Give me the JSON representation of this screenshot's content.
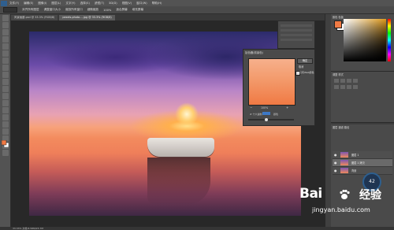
{
  "menubar": {
    "items": [
      "文件(F)",
      "编辑(E)",
      "图像(I)",
      "图层(L)",
      "文字(Y)",
      "选择(S)",
      "滤镜(T)",
      "3D(D)",
      "视图(V)",
      "窗口(W)",
      "帮助(H)"
    ]
  },
  "optionsbar": {
    "items": [
      "对齐所有图层",
      "调整窗口大小",
      "缩放所有窗口",
      "细微缩放",
      "100%",
      "适合屏幕",
      "填充屏幕"
    ]
  },
  "tabs": [
    "风景画廊.psd @ 33.3% (RGB/8)",
    "pexels-photo-...jpg @ 33.3% (RGB/8)"
  ],
  "colorpicker": {
    "title": "拾色器(前景色)",
    "ok": "确定",
    "cancel": "取消",
    "only_web": "只有Web颜色",
    "zoom": "100%",
    "zoom_minus": "−",
    "zoom_plus": "+",
    "hex_label": "# 十六进制",
    "hex_suffix": "颜色",
    "swatch_color": "#f39a6b"
  },
  "colorpanel": {
    "tabs": "颜色  色板",
    "fg_color": "#f07a44"
  },
  "adjpanel": {
    "tabs": "调整  样式"
  },
  "layerpanel": {
    "tabs": "图层  通道  路径",
    "layers": [
      {
        "name": "图层 1"
      },
      {
        "name": "图层 1 拷贝"
      },
      {
        "name": "背景"
      }
    ]
  },
  "zoom_badge": "42",
  "statusbar": {
    "text": "33.33%   文档:8.58M/25.7M"
  },
  "watermark": {
    "bai": "Bai",
    "jingyan": "经验",
    "url": "jingyan.baidu.com"
  }
}
